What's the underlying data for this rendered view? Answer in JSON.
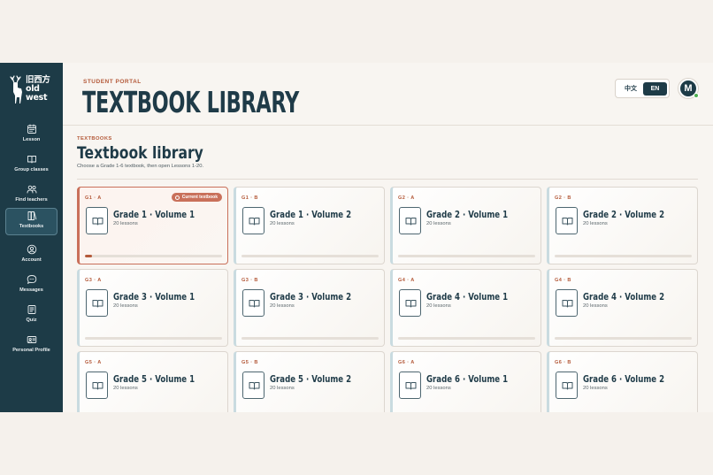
{
  "brand": {
    "logo_text": "旧西方 old west"
  },
  "sidebar": {
    "items": [
      {
        "label": "Lesson",
        "icon": "calendar-icon"
      },
      {
        "label": "Group classes",
        "icon": "book-icon"
      },
      {
        "label": "Find teachers",
        "icon": "users-icon"
      },
      {
        "label": "Textbooks",
        "icon": "textbooks-icon",
        "active": true
      },
      {
        "label": "Account",
        "icon": "user-circle-icon"
      },
      {
        "label": "Messages",
        "icon": "chat-icon"
      },
      {
        "label": "Quiz",
        "icon": "quiz-icon"
      },
      {
        "label": "Personal Profile",
        "icon": "profile-card-icon"
      }
    ]
  },
  "header": {
    "eyebrow": "STUDENT PORTAL",
    "title": "TEXTBOOK LIBRARY",
    "lang_zh": "中文",
    "lang_en": "EN",
    "active_lang": "EN",
    "avatar_initial": "M"
  },
  "section": {
    "eyebrow": "TEXTBOOKS",
    "title": "Textbook library",
    "subtitle": "Choose a Grade 1-6 textbook, then open Lessons 1-20."
  },
  "cards": [
    {
      "code": "G1 · A",
      "title": "Grade 1 · Volume 1",
      "lessons": "20 lessons",
      "current": true,
      "badge": "Current textbook",
      "progress": 0.05
    },
    {
      "code": "G1 · B",
      "title": "Grade 1 · Volume 2",
      "lessons": "20 lessons",
      "progress": 0
    },
    {
      "code": "G2 · A",
      "title": "Grade 2 · Volume 1",
      "lessons": "20 lessons",
      "progress": 0
    },
    {
      "code": "G2 · B",
      "title": "Grade 2 · Volume 2",
      "lessons": "20 lessons",
      "progress": 0
    },
    {
      "code": "G3 · A",
      "title": "Grade 3 · Volume 1",
      "lessons": "20 lessons",
      "progress": 0
    },
    {
      "code": "G3 · B",
      "title": "Grade 3 · Volume 2",
      "lessons": "20 lessons",
      "progress": 0
    },
    {
      "code": "G4 · A",
      "title": "Grade 4 · Volume 1",
      "lessons": "20 lessons",
      "progress": 0
    },
    {
      "code": "G4 · B",
      "title": "Grade 4 · Volume 2",
      "lessons": "20 lessons",
      "progress": 0
    },
    {
      "code": "G5 · A",
      "title": "Grade 5 · Volume 1",
      "lessons": "20 lessons",
      "progress": 0
    },
    {
      "code": "G5 · B",
      "title": "Grade 5 · Volume 2",
      "lessons": "20 lessons",
      "progress": 0
    },
    {
      "code": "G6 · A",
      "title": "Grade 6 · Volume 1",
      "lessons": "20 lessons",
      "progress": 0
    },
    {
      "code": "G6 · B",
      "title": "Grade 6 · Volume 2",
      "lessons": "20 lessons",
      "progress": 0
    }
  ],
  "colors": {
    "sidebar": "#1d3b47",
    "accent": "#b45a3a",
    "current_card": "#c9705a",
    "online": "#4caf50"
  }
}
